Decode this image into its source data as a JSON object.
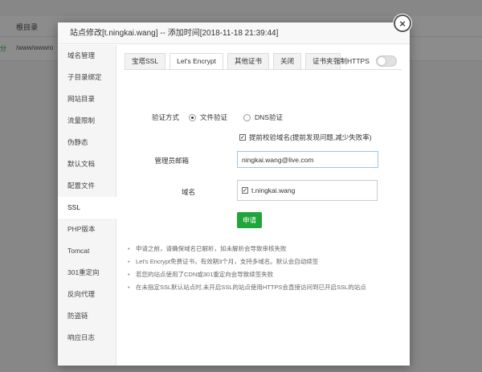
{
  "background": {
    "column_header": "根目录",
    "row_prefix": "分",
    "row_path": "/www/wwwro"
  },
  "modal": {
    "title": "站点修改[t.ningkai.wang] -- 添加时间[2018-11-18 21:39:44]",
    "close_glyph": "×"
  },
  "sidebar": {
    "items": [
      {
        "label": "域名管理"
      },
      {
        "label": "子目录绑定"
      },
      {
        "label": "网站目录"
      },
      {
        "label": "流量限制"
      },
      {
        "label": "伪静态"
      },
      {
        "label": "默认文档"
      },
      {
        "label": "配置文件"
      },
      {
        "label": "SSL"
      },
      {
        "label": "PHP版本"
      },
      {
        "label": "Tomcat"
      },
      {
        "label": "301重定向"
      },
      {
        "label": "反向代理"
      },
      {
        "label": "防盗链"
      },
      {
        "label": "响应日志"
      }
    ],
    "active_index": 7
  },
  "tabs": [
    {
      "label": "宝塔SSL"
    },
    {
      "label": "Let's Encrypt"
    },
    {
      "label": "其他证书"
    },
    {
      "label": "关闭"
    },
    {
      "label": "证书夹"
    }
  ],
  "active_tab": 1,
  "force_https": {
    "label": "强制HTTPS",
    "enabled": false
  },
  "form": {
    "verify_label": "验证方式",
    "verify_options": [
      {
        "label": "文件验证",
        "checked": true
      },
      {
        "label": "DNS验证",
        "checked": false
      }
    ],
    "precheck_label": "提前校验域名(提前发现问题,减少失败率)",
    "precheck_checked": true,
    "check_glyph": "✓",
    "email_label": "管理员邮箱",
    "email_value": "ningkai.wang@live.com",
    "domain_label": "域名",
    "domain_value": "t.ningkai.wang",
    "apply_label": "申请"
  },
  "notes": [
    "申请之前，请确保域名已解析，如未解析会导致审核失败",
    "Let's Encrypt免费证书，有效期3个月，支持多域名。默认会自动续签",
    "若您的站点使用了CDN或301重定向会导致续签失败",
    "在未指定SSL默认站点时,未开启SSL的站点使用HTTPS会直接访问到已开启SSL的站点"
  ],
  "colors": {
    "accent": "#20a53a",
    "input_border": "#9fc3e8"
  }
}
